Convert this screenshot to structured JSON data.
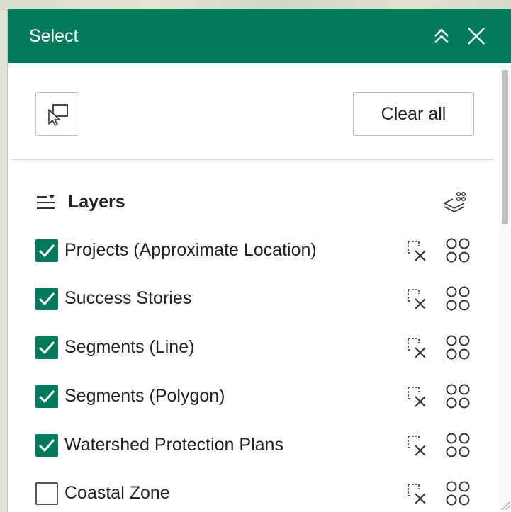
{
  "header": {
    "title": "Select",
    "collapse_icon": "double-chevron-up-icon",
    "close_icon": "close-icon"
  },
  "toolbar": {
    "select_tool_icon": "select-by-pointer-icon",
    "clear_all_label": "Clear all"
  },
  "layers": {
    "title": "Layers",
    "header_icon": "list-options-icon",
    "options_icon": "layers-select-options-icon",
    "items": [
      {
        "label": "Projects (Approximate Location)",
        "checked": true
      },
      {
        "label": "Success Stories",
        "checked": true
      },
      {
        "label": "Segments (Line)",
        "checked": true
      },
      {
        "label": "Segments (Polygon)",
        "checked": true
      },
      {
        "label": "Watershed Protection Plans",
        "checked": true
      },
      {
        "label": "Coastal Zone",
        "checked": false
      }
    ]
  },
  "colors": {
    "brand": "#007a5b",
    "header_text": "#ffffff",
    "text": "#222222"
  }
}
